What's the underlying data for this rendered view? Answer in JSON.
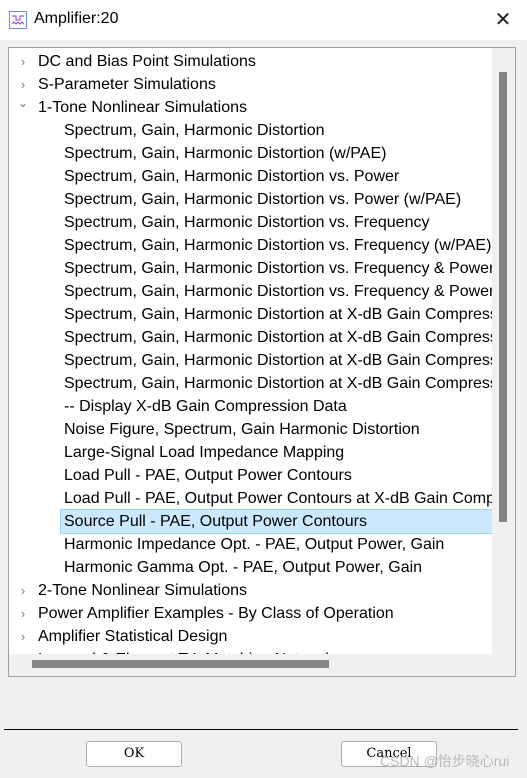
{
  "window": {
    "title": "Amplifier:20",
    "icon": "schematic-icon",
    "close_icon": "close-icon"
  },
  "tree": {
    "items": [
      {
        "label": "DC and Bias Point Simulations",
        "level": 0,
        "state": "collapsed"
      },
      {
        "label": "S-Parameter Simulations",
        "level": 0,
        "state": "collapsed"
      },
      {
        "label": "1-Tone Nonlinear Simulations",
        "level": 0,
        "state": "expanded"
      },
      {
        "label": "Spectrum, Gain, Harmonic Distortion",
        "level": 1
      },
      {
        "label": "Spectrum, Gain, Harmonic Distortion (w/PAE)",
        "level": 1
      },
      {
        "label": "Spectrum, Gain, Harmonic Distortion vs. Power",
        "level": 1
      },
      {
        "label": "Spectrum, Gain, Harmonic Distortion vs. Power (w/PAE)",
        "level": 1
      },
      {
        "label": "Spectrum, Gain, Harmonic Distortion vs. Frequency",
        "level": 1
      },
      {
        "label": "Spectrum, Gain, Harmonic Distortion vs. Frequency (w/PAE)",
        "level": 1
      },
      {
        "label": "Spectrum, Gain, Harmonic Distortion vs. Frequency & Power",
        "level": 1
      },
      {
        "label": "Spectrum, Gain, Harmonic Distortion vs. Frequency & Power",
        "level": 1
      },
      {
        "label": "Spectrum, Gain, Harmonic Distortion at X-dB Gain Compression",
        "level": 1
      },
      {
        "label": "Spectrum, Gain, Harmonic Distortion at X-dB Gain Compression",
        "level": 1
      },
      {
        "label": "Spectrum, Gain, Harmonic Distortion at X-dB Gain Compression",
        "level": 1
      },
      {
        "label": "Spectrum, Gain, Harmonic Distortion at X-dB Gain Compression",
        "level": 1
      },
      {
        "label": "-- Display X-dB Gain Compression Data",
        "level": 1
      },
      {
        "label": "Noise Figure, Spectrum, Gain Harmonic Distortion",
        "level": 1
      },
      {
        "label": "Large-Signal Load Impedance Mapping",
        "level": 1
      },
      {
        "label": "Load Pull - PAE, Output Power Contours",
        "level": 1
      },
      {
        "label": "Load Pull - PAE, Output Power Contours at X-dB Gain Compression",
        "level": 1
      },
      {
        "label": "Source Pull - PAE, Output Power Contours",
        "level": 1,
        "selected": true
      },
      {
        "label": "Harmonic Impedance Opt. - PAE, Output Power, Gain",
        "level": 1
      },
      {
        "label": "Harmonic Gamma Opt. - PAE, Output Power, Gain",
        "level": 1
      },
      {
        "label": "2-Tone Nonlinear Simulations",
        "level": 0,
        "state": "collapsed"
      },
      {
        "label": "Power Amplifier Examples - By Class of Operation",
        "level": 0,
        "state": "collapsed"
      },
      {
        "label": "Amplifier Statistical Design",
        "level": 0,
        "state": "collapsed"
      },
      {
        "label": "Lumped & Element T-L Matching Networks",
        "level": 0,
        "state": "collapsed"
      }
    ]
  },
  "buttons": {
    "ok": "OK",
    "cancel": "Cancel"
  },
  "watermark": "CSDN @怡步晓心rui",
  "colors": {
    "selection": "#cce8ff",
    "selection_border": "#99d1ff"
  }
}
